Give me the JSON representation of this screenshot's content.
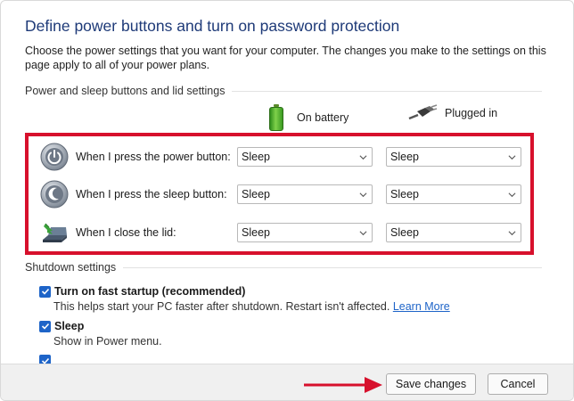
{
  "page": {
    "title": "Define power buttons and turn on password protection",
    "description": "Choose the power settings that you want for your computer. The changes you make to the settings on this page apply to all of your power plans."
  },
  "power_section": {
    "header": "Power and sleep buttons and lid settings",
    "col_battery": "On battery",
    "col_plugged": "Plugged in",
    "battery_icon": "battery-icon",
    "plug_icon": "plug-icon",
    "rows": [
      {
        "label": "When I press the power button:",
        "icon": "power-button-icon",
        "battery": "Sleep",
        "plugged": "Sleep"
      },
      {
        "label": "When I press the sleep button:",
        "icon": "sleep-button-icon",
        "battery": "Sleep",
        "plugged": "Sleep"
      },
      {
        "label": "When I close the lid:",
        "icon": "laptop-lid-icon",
        "battery": "Sleep",
        "plugged": "Sleep"
      }
    ]
  },
  "shutdown_section": {
    "header": "Shutdown settings",
    "fast_startup": {
      "label": "Turn on fast startup (recommended)",
      "checked": true,
      "help_text": "This helps start your PC faster after shutdown. Restart isn't affected.",
      "link_text": "Learn More"
    },
    "sleep": {
      "label": "Sleep",
      "checked": true,
      "help_text": "Show in Power menu."
    },
    "hibernate": {
      "checked": true
    }
  },
  "footer": {
    "save_label": "Save changes",
    "cancel_label": "Cancel"
  },
  "colors": {
    "title": "#1e3a78",
    "highlight_box": "#d7102c",
    "checkbox": "#1e64c8",
    "link": "#1e64c8"
  }
}
